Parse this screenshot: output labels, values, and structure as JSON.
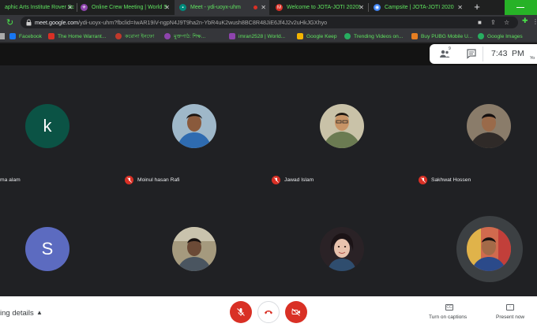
{
  "tabs": [
    {
      "title": "aphic Arts Institute Rover Sc",
      "color": "#3b7ddd"
    },
    {
      "title": "Online Crew Meeting | World S",
      "color": "#8e44ad"
    },
    {
      "title": "Meet - ydi-uoyx-uhm",
      "color": "#00897b"
    },
    {
      "title": "Welcome to JOTA-JOTI 2020!",
      "color": "#d93025"
    },
    {
      "title": "Campsite | JOTA-JOTI 2020",
      "color": "#4285f4"
    }
  ],
  "address": {
    "host": "meet.google.com",
    "path": "/ydi-uoyx-uhm?fbclid=IwAR19iV-ngpN4J9T9ha2n-YbR4uK2wush8BC8R48JiE6Jf4J2v2uHkJGXhyo"
  },
  "bookmarks": [
    {
      "label": "Facebook",
      "color": "#1877f2"
    },
    {
      "label": "The Home Warrant...",
      "color": "#d93025"
    },
    {
      "label": "করোনা ইনফো",
      "color": "#c0392b"
    },
    {
      "label": "মুক্তপাঠ: শিক্ষ...",
      "color": "#8e44ad"
    },
    {
      "label": "imran2528 | World...",
      "color": "#8e44ad"
    },
    {
      "label": "Google Keep",
      "color": "#f4b400"
    },
    {
      "label": "Trending Videos on...",
      "color": "#27ae60"
    },
    {
      "label": "Buy PUBG Mobile U...",
      "color": "#e67e22"
    },
    {
      "label": "Google Images",
      "color": "#27ae60"
    }
  ],
  "meet_top": {
    "people_badge": "9",
    "time": "7:43",
    "ampm": "PM",
    "you_label": "Yo"
  },
  "participants": [
    {
      "name": "ma alam",
      "initial": "k",
      "bg": "#0b5345",
      "muted": false
    },
    {
      "name": "Moinul hasan Rafi",
      "initial": "",
      "bg": "#2e6bb0",
      "muted": true
    },
    {
      "name": "Jawad Islam",
      "initial": "",
      "bg": "#7a8c6a",
      "muted": true
    },
    {
      "name": "Sakhwat Hossen",
      "initial": "",
      "bg": "#5d4a3a",
      "muted": true
    },
    {
      "name": "",
      "initial": "S",
      "bg": "#5c6bc0",
      "muted": false
    },
    {
      "name": "",
      "initial": "",
      "bg": "#6b5a48",
      "muted": false
    },
    {
      "name": "",
      "initial": "",
      "bg": "#3a2f33",
      "muted": false
    },
    {
      "name": "",
      "initial": "",
      "bg": "#b5634a",
      "muted": false
    }
  ],
  "bottom": {
    "details_label": "ing details",
    "captions_label": "Turn on captions",
    "present_label": "Present now",
    "captions_icon": "CC"
  },
  "accent_red": "#d93025"
}
